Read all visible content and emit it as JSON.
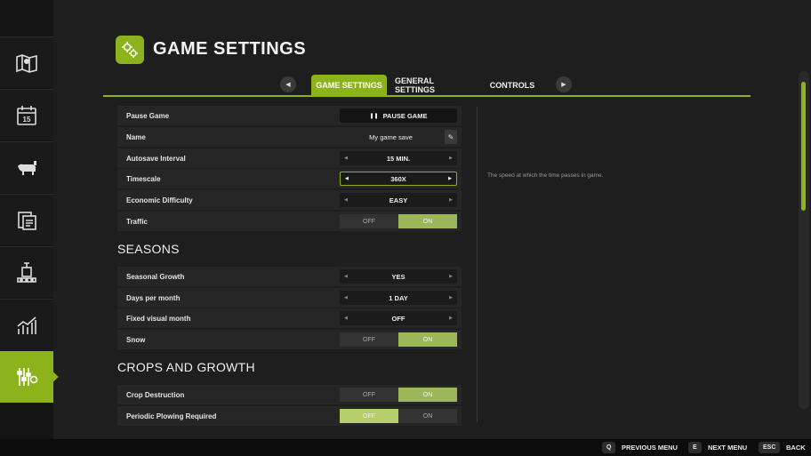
{
  "header": {
    "title": "GAME SETTINGS",
    "icon": "gears-icon"
  },
  "tabs": [
    {
      "label": "GAME SETTINGS",
      "active": true
    },
    {
      "label": "GENERAL SETTINGS",
      "active": false
    },
    {
      "label": "CONTROLS",
      "active": false
    }
  ],
  "tab_nav": {
    "prev": "◀",
    "next": "▶"
  },
  "sidebar": {
    "items": [
      {
        "icon": "map-icon"
      },
      {
        "icon": "calendar-icon",
        "text": "15"
      },
      {
        "icon": "animals-icon"
      },
      {
        "icon": "contracts-icon"
      },
      {
        "icon": "production-icon"
      },
      {
        "icon": "statistics-icon"
      },
      {
        "icon": "settings-icon",
        "active": true
      }
    ]
  },
  "settings": {
    "pause_game": {
      "label": "Pause Game",
      "button": "PAUSE GAME",
      "button_icon": "❚❚"
    },
    "name": {
      "label": "Name",
      "value": "My game save",
      "edit_icon": "✎"
    },
    "autosave": {
      "label": "Autosave Interval",
      "value": "15 MIN."
    },
    "timescale": {
      "label": "Timescale",
      "value": "360X"
    },
    "difficulty": {
      "label": "Economic Difficulty",
      "value": "EASY"
    },
    "traffic": {
      "label": "Traffic",
      "off": "OFF",
      "on": "ON"
    }
  },
  "seasons": {
    "title": "SEASONS",
    "growth": {
      "label": "Seasonal Growth",
      "value": "YES"
    },
    "days": {
      "label": "Days per month",
      "value": "1 DAY"
    },
    "fixed_month": {
      "label": "Fixed visual month",
      "value": "OFF"
    },
    "snow": {
      "label": "Snow",
      "off": "OFF",
      "on": "ON"
    }
  },
  "crops": {
    "title": "CROPS AND GROWTH",
    "destruction": {
      "label": "Crop Destruction",
      "off": "OFF",
      "on": "ON"
    },
    "plowing": {
      "label": "Periodic Plowing Required",
      "off": "OFF",
      "on": "ON"
    }
  },
  "arrows": {
    "left": "◀",
    "right": "▶"
  },
  "description": "The speed at which the time passes in game.",
  "footer": [
    {
      "key": "Q",
      "label": "PREVIOUS MENU"
    },
    {
      "key": "E",
      "label": "NEXT MENU"
    },
    {
      "key": "ESC",
      "label": "BACK"
    }
  ],
  "colors": {
    "accent": "#8cb31c",
    "background": "#1e1e1e",
    "toggle_on": "#9cb75a"
  }
}
